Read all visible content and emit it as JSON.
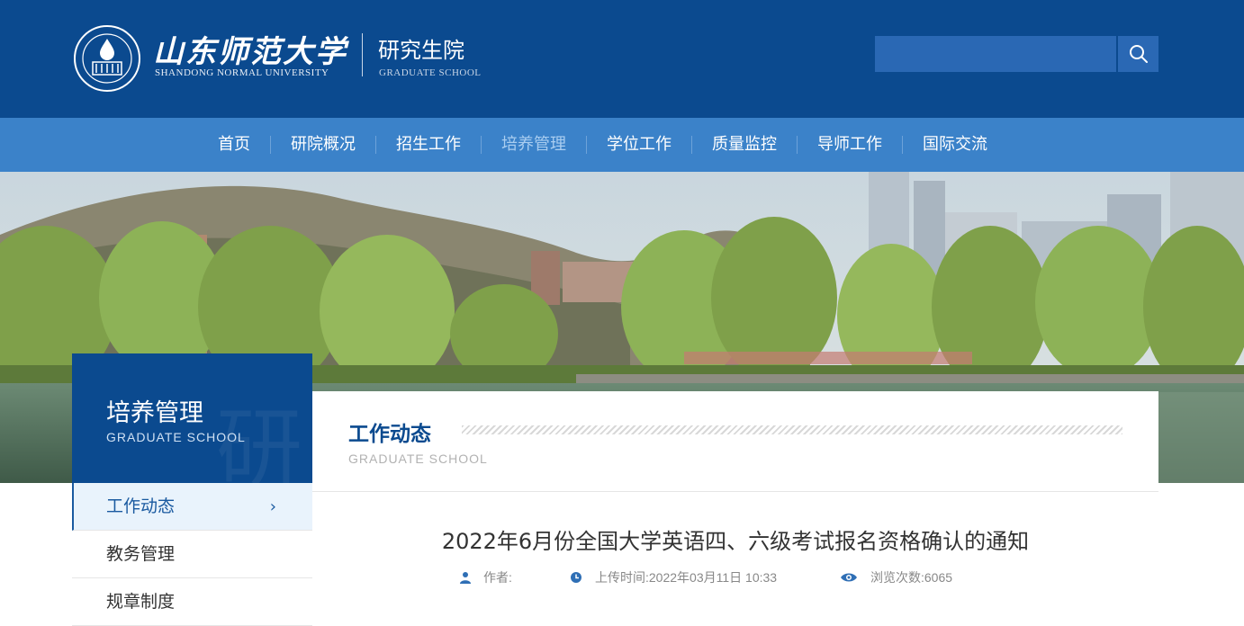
{
  "header": {
    "university_cn": "山东师范大学",
    "university_en": "SHANDONG NORMAL UNIVERSITY",
    "school_cn": "研究生院",
    "school_en": "GRADUATE SCHOOL",
    "search_placeholder": "",
    "brand_color": "#0b4a8f"
  },
  "nav": {
    "items": [
      "首页",
      "研院概况",
      "招生工作",
      "培养管理",
      "学位工作",
      "质量监控",
      "导师工作",
      "国际交流"
    ],
    "active_index": 3,
    "bar_color": "#3b82c9"
  },
  "sidebar": {
    "title": "培养管理",
    "subtitle": "GRADUATE SCHOOL",
    "watermark": "研",
    "items": [
      "工作动态",
      "教务管理",
      "规章制度"
    ],
    "active_index": 0
  },
  "content": {
    "section_title": "工作动态",
    "section_subtitle": "GRADUATE SCHOOL",
    "article": {
      "title": "2022年6月份全国大学英语四、六级考试报名资格确认的通知",
      "author_label": "作者:",
      "upload_label": "上传时间:2022年03月11日 10:33",
      "views_label": "浏览次数:6065"
    }
  },
  "icons": {
    "search": "search-icon",
    "author": "user-icon",
    "time": "clock-icon",
    "views": "eye-icon",
    "arrow": "chevron-right-icon"
  }
}
